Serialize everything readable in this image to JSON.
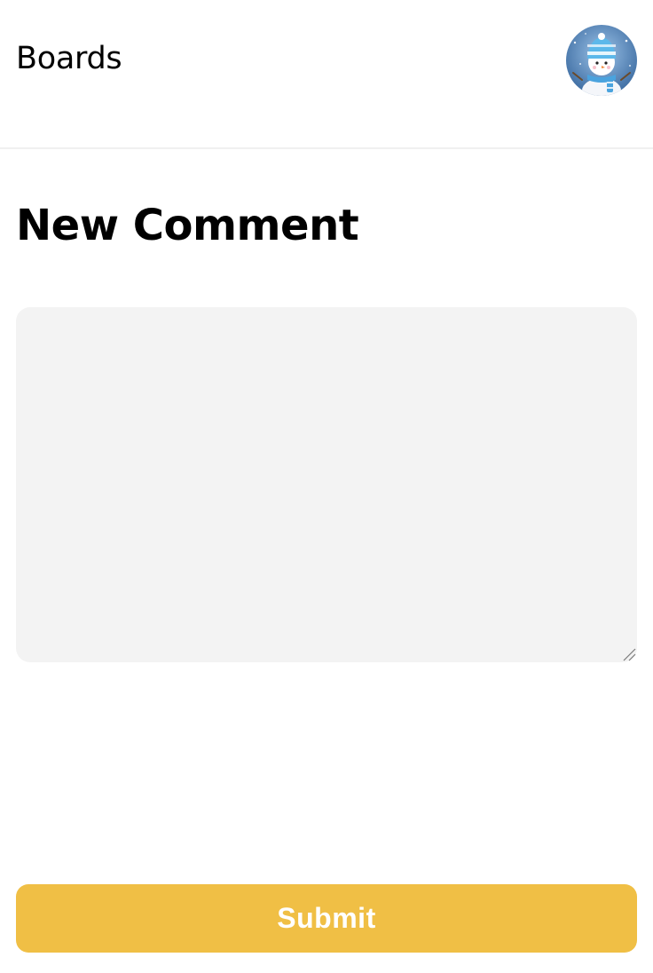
{
  "header": {
    "boards_label": "Boards",
    "avatar_icon": "snowman-avatar-icon"
  },
  "main": {
    "title": "New Comment",
    "comment_field": {
      "value": "",
      "placeholder": ""
    },
    "submit_label": "Submit"
  },
  "colors": {
    "accent": "#f0bf45",
    "field_background": "#f3f3f3",
    "divider": "#f0f0f0"
  }
}
